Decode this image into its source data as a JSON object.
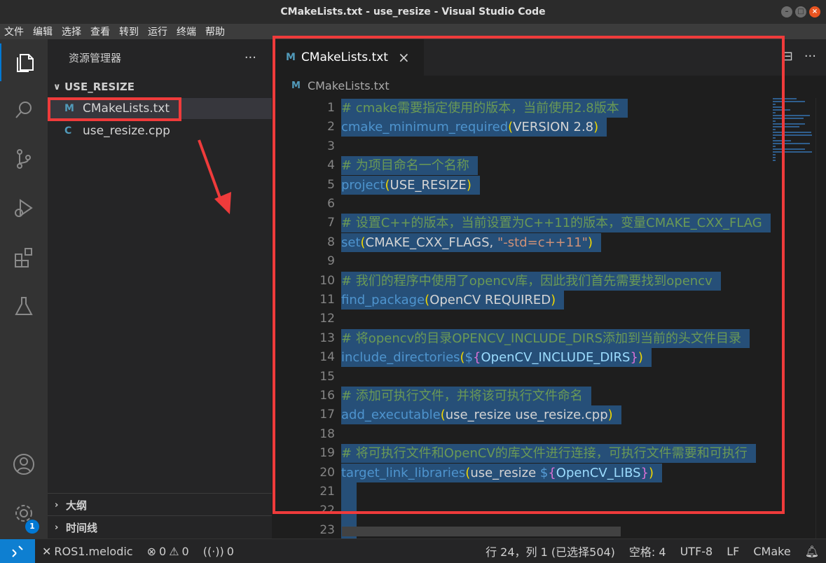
{
  "window": {
    "title": "CMakeLists.txt - use_resize - Visual Studio Code",
    "buttons": [
      "–",
      "□",
      "×"
    ]
  },
  "menu": [
    "文件",
    "编辑",
    "选择",
    "查看",
    "转到",
    "运行",
    "终端",
    "帮助"
  ],
  "activity_bar": {
    "icons": [
      "explorer-icon",
      "search-icon",
      "source-control-icon",
      "run-debug-icon",
      "extensions-icon",
      "testing-icon",
      "account-icon",
      "settings-gear-icon"
    ],
    "settings_badge": "1"
  },
  "sidebar": {
    "title": "资源管理器",
    "more": "···",
    "folder": "USE_RESIZE",
    "files": [
      {
        "icon": "M",
        "name": "CMakeLists.txt"
      },
      {
        "icon": "C",
        "name": "use_resize.cpp"
      }
    ],
    "outline": "大纲",
    "timeline": "时间线"
  },
  "editor": {
    "tab_label": "CMakeLists.txt",
    "tab_icon": "M",
    "tab_close": "×",
    "actions": [
      "⊟",
      "···"
    ],
    "breadcrumb": "CMakeLists.txt",
    "lines": [
      {
        "n": "1",
        "parts": [
          {
            "t": "# cmake需要指定使用的版本，当前使用2.8版本",
            "c": "comment"
          }
        ]
      },
      {
        "n": "2",
        "parts": [
          {
            "t": "cmake_minimum_required",
            "c": "func"
          },
          {
            "t": "(",
            "c": "paren"
          },
          {
            "t": "VERSION 2.8",
            "c": "arg"
          },
          {
            "t": ")",
            "c": "paren"
          }
        ]
      },
      {
        "n": "3",
        "parts": []
      },
      {
        "n": "4",
        "parts": [
          {
            "t": "# 为项目命名一个名称",
            "c": "comment"
          }
        ]
      },
      {
        "n": "5",
        "parts": [
          {
            "t": "project",
            "c": "func"
          },
          {
            "t": "(",
            "c": "paren"
          },
          {
            "t": "USE_RESIZE",
            "c": "arg"
          },
          {
            "t": ")",
            "c": "paren"
          }
        ]
      },
      {
        "n": "6",
        "parts": []
      },
      {
        "n": "7",
        "parts": [
          {
            "t": "# 设置C++的版本，当前设置为C++11的版本，变量CMAKE_CXX_FLAG",
            "c": "comment"
          }
        ]
      },
      {
        "n": "8",
        "parts": [
          {
            "t": "set",
            "c": "func"
          },
          {
            "t": "(",
            "c": "paren"
          },
          {
            "t": "CMAKE_CXX_FLAGS, ",
            "c": "arg"
          },
          {
            "t": "\"-std=c++11\"",
            "c": "str"
          },
          {
            "t": ")",
            "c": "paren"
          }
        ]
      },
      {
        "n": "9",
        "parts": []
      },
      {
        "n": "10",
        "parts": [
          {
            "t": "# 我们的程序中使用了opencv库，因此我们首先需要找到opencv",
            "c": "comment"
          }
        ]
      },
      {
        "n": "11",
        "parts": [
          {
            "t": "find_package",
            "c": "func"
          },
          {
            "t": "(",
            "c": "paren"
          },
          {
            "t": "OpenCV REQUIRED",
            "c": "arg"
          },
          {
            "t": ")",
            "c": "paren"
          }
        ]
      },
      {
        "n": "12",
        "parts": []
      },
      {
        "n": "13",
        "parts": [
          {
            "t": "# 将opencv的目录OPENCV_INCLUDE_DIRS添加到当前的头文件目录",
            "c": "comment"
          }
        ]
      },
      {
        "n": "14",
        "parts": [
          {
            "t": "include_directories",
            "c": "func"
          },
          {
            "t": "(",
            "c": "paren"
          },
          {
            "t": "$",
            "c": "dollar"
          },
          {
            "t": "{",
            "c": "brace"
          },
          {
            "t": "OpenCV_INCLUDE_DIRS",
            "c": "var"
          },
          {
            "t": "}",
            "c": "brace"
          },
          {
            "t": ")",
            "c": "paren"
          }
        ]
      },
      {
        "n": "15",
        "parts": []
      },
      {
        "n": "16",
        "parts": [
          {
            "t": "# 添加可执行文件，并将该可执行文件命名",
            "c": "comment"
          }
        ]
      },
      {
        "n": "17",
        "parts": [
          {
            "t": "add_executable",
            "c": "func"
          },
          {
            "t": "(",
            "c": "paren"
          },
          {
            "t": "use_resize use_resize.cpp",
            "c": "arg"
          },
          {
            "t": ")",
            "c": "paren"
          }
        ]
      },
      {
        "n": "18",
        "parts": []
      },
      {
        "n": "19",
        "parts": [
          {
            "t": "# 将可执行文件和OpenCV的库文件进行连接，可执行文件需要和可执行",
            "c": "comment"
          }
        ]
      },
      {
        "n": "20",
        "parts": [
          {
            "t": "target_link_libraries",
            "c": "func"
          },
          {
            "t": "(",
            "c": "paren"
          },
          {
            "t": "use_resize ",
            "c": "arg"
          },
          {
            "t": "$",
            "c": "dollar"
          },
          {
            "t": "{",
            "c": "brace"
          },
          {
            "t": "OpenCV_LIBS",
            "c": "var"
          },
          {
            "t": "}",
            "c": "brace"
          },
          {
            "t": ")",
            "c": "paren"
          }
        ]
      },
      {
        "n": "21",
        "parts": []
      },
      {
        "n": "22",
        "parts": []
      },
      {
        "n": "23",
        "parts": []
      }
    ]
  },
  "statusbar": {
    "remote_icon": "remote-icon",
    "ros": "ROS1.melodic",
    "errors": "0",
    "warnings": "0",
    "ports": "0",
    "cursor": "行 24，列 1 (已选择504)",
    "spaces": "空格: 4",
    "encoding": "UTF-8",
    "eol": "LF",
    "language": "CMake"
  },
  "colors": {
    "annotation_red": "#ef3b3b",
    "selection": "#264f78",
    "accent": "#0078d4"
  }
}
